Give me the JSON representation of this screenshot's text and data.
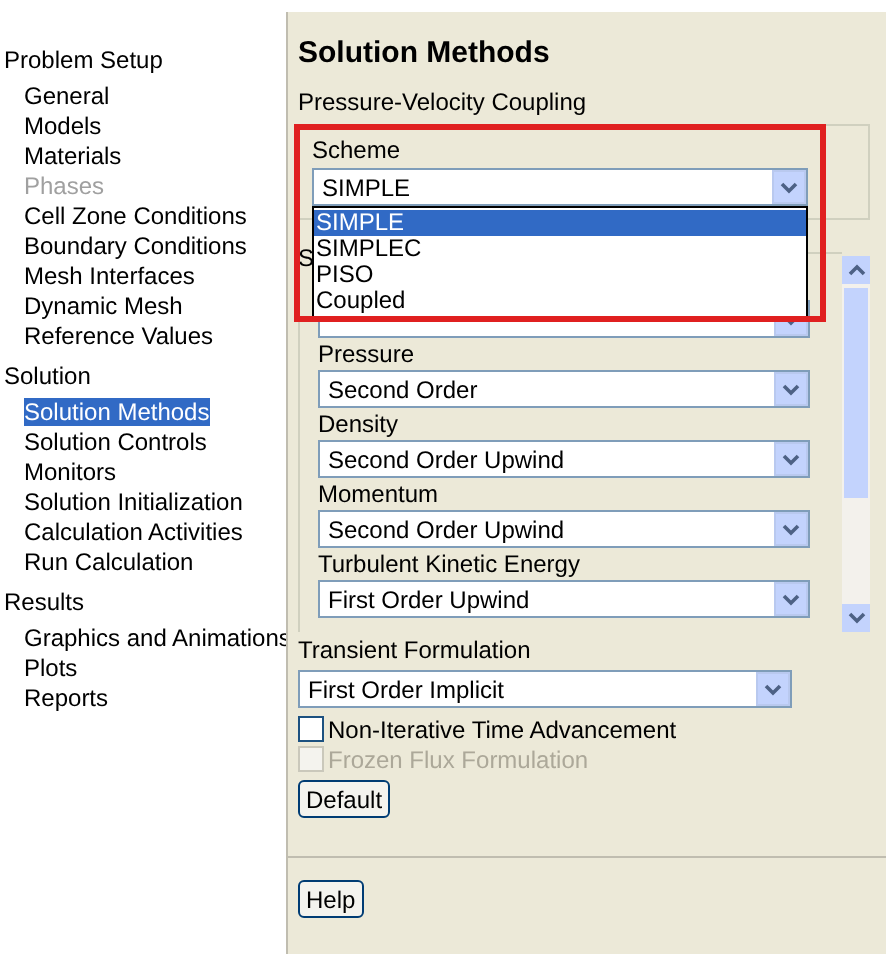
{
  "sidebar": {
    "sections": [
      {
        "label": "Problem Setup",
        "items": [
          {
            "label": "General",
            "selected": false,
            "disabled": false
          },
          {
            "label": "Models",
            "selected": false,
            "disabled": false
          },
          {
            "label": "Materials",
            "selected": false,
            "disabled": false
          },
          {
            "label": "Phases",
            "selected": false,
            "disabled": true
          },
          {
            "label": "Cell Zone Conditions",
            "selected": false,
            "disabled": false
          },
          {
            "label": "Boundary Conditions",
            "selected": false,
            "disabled": false
          },
          {
            "label": "Mesh Interfaces",
            "selected": false,
            "disabled": false
          },
          {
            "label": "Dynamic Mesh",
            "selected": false,
            "disabled": false
          },
          {
            "label": "Reference Values",
            "selected": false,
            "disabled": false
          }
        ]
      },
      {
        "label": "Solution",
        "items": [
          {
            "label": "Solution Methods",
            "selected": true,
            "disabled": false
          },
          {
            "label": "Solution Controls",
            "selected": false,
            "disabled": false
          },
          {
            "label": "Monitors",
            "selected": false,
            "disabled": false
          },
          {
            "label": "Solution Initialization",
            "selected": false,
            "disabled": false
          },
          {
            "label": "Calculation Activities",
            "selected": false,
            "disabled": false
          },
          {
            "label": "Run Calculation",
            "selected": false,
            "disabled": false
          }
        ]
      },
      {
        "label": "Results",
        "items": [
          {
            "label": "Graphics and Animations",
            "selected": false,
            "disabled": false
          },
          {
            "label": "Plots",
            "selected": false,
            "disabled": false
          },
          {
            "label": "Reports",
            "selected": false,
            "disabled": false
          }
        ]
      }
    ]
  },
  "panel": {
    "title": "Solution Methods",
    "coupling": {
      "label": "Pressure-Velocity Coupling",
      "scheme_label": "Scheme",
      "scheme_value": "SIMPLE",
      "highlighted": true,
      "options": [
        {
          "label": "SIMPLE",
          "selected": true
        },
        {
          "label": "SIMPLEC",
          "selected": false
        },
        {
          "label": "PISO",
          "selected": false
        },
        {
          "label": "Coupled",
          "selected": false
        }
      ]
    },
    "spatial": {
      "label": "S",
      "fields": [
        {
          "kind": "covered"
        },
        {
          "kind": "dropdown",
          "label": "Pressure",
          "value": "Second Order"
        },
        {
          "kind": "dropdown",
          "label": "Density",
          "value": "Second Order Upwind"
        },
        {
          "kind": "dropdown",
          "label": "Momentum",
          "value": "Second Order Upwind"
        },
        {
          "kind": "dropdown",
          "label": "Turbulent Kinetic Energy",
          "value": "First Order Upwind"
        }
      ]
    },
    "transient": {
      "label": "Transient Formulation",
      "value": "First Order Implicit"
    },
    "checkboxes": [
      {
        "label": "Non-Iterative Time Advancement",
        "checked": false,
        "disabled": false
      },
      {
        "label": "Frozen Flux Formulation",
        "checked": false,
        "disabled": true
      }
    ],
    "default_button": "Default",
    "help_button": "Help"
  }
}
